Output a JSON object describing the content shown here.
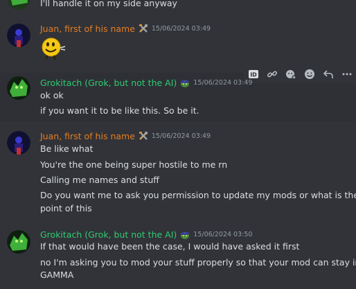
{
  "top_fragment": {
    "text": "I'll handle it on my side anyway"
  },
  "messages": [
    {
      "author": "Juan, first of his name",
      "author_color": "#e67e22",
      "timestamp": "15/06/2024 03:49",
      "role_icon": "tools-icon",
      "lines": [],
      "attachment": "grinning-face-sticker"
    },
    {
      "author": "Grokitach (Grok, but not the AI)",
      "author_color": "#2ecc71",
      "timestamp": "15/06/2024 03:49",
      "role_icon": "goblin-emoji-icon",
      "lines": [
        "ok ok",
        "if you want it to be like this. So be it."
      ]
    },
    {
      "author": "Juan, first of his name",
      "author_color": "#e67e22",
      "timestamp": "15/06/2024 03:49",
      "role_icon": "tools-icon",
      "lines": [
        "Be like what",
        "You're the one being super hostile to me rn",
        "Calling me names and stuff",
        "Do you want me to ask you permission to update my mods or what is the",
        "point of this"
      ]
    },
    {
      "author": "Grokitach (Grok, but not the AI)",
      "author_color": "#2ecc71",
      "timestamp": "15/06/2024 03:50",
      "role_icon": "goblin-emoji-icon",
      "lines": [
        "If that would have been the case, I would have asked it first",
        "no I'm asking you to mod your stuff properly so that your mod can stay in",
        "GAMMA"
      ]
    }
  ],
  "toolbar": {
    "buttons": [
      "id-icon",
      "link-icon",
      "add-reaction-icon",
      "emoji-icon",
      "reply-icon",
      "more-icon"
    ],
    "id_label": "ID"
  },
  "colors": {
    "background": "#313338",
    "timestamp": "#949ba4",
    "text": "#dbdee1"
  }
}
